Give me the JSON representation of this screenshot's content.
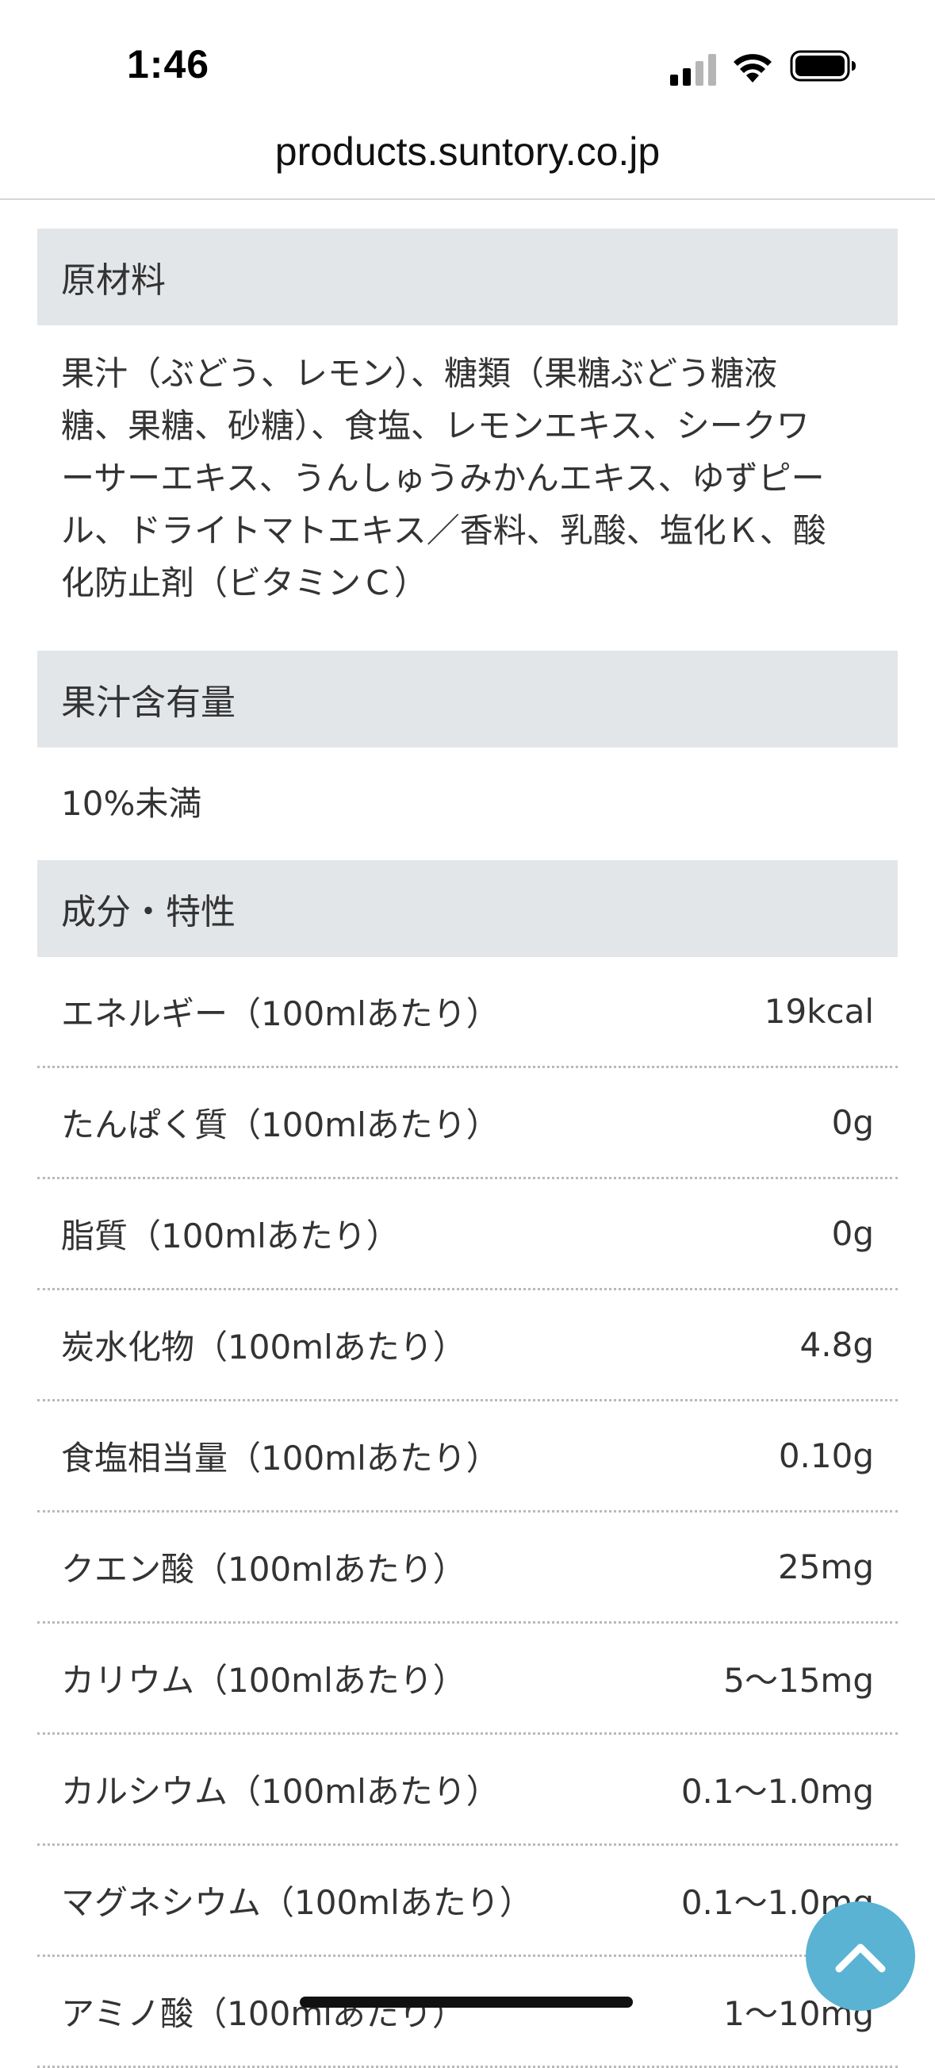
{
  "status_bar": {
    "time": "1:46"
  },
  "url_bar": {
    "domain": "products.suntory.co.jp"
  },
  "sections": {
    "ingredients": {
      "title": "原材料",
      "lines": [
        "果汁（ぶどう、レモン）、糖類（果糖ぶどう糖液",
        "糖、果糖、砂糖）、食塩、レモンエキス、シークワ",
        "ーサーエキス、うんしゅうみかんエキス、ゆずピー",
        "ル、ドライトマトエキス／香料、乳酸、塩化Ｋ、酸",
        "化防止剤（ビタミンＣ）"
      ]
    },
    "juice_content": {
      "title": "果汁含有量",
      "value": "10%未満"
    },
    "nutrition": {
      "title": "成分・特性",
      "rows": [
        {
          "label": "エネルギー（100mlあたり）",
          "value": "19kcal"
        },
        {
          "label": "たんぱく質（100mlあたり）",
          "value": "0g"
        },
        {
          "label": "脂質（100mlあたり）",
          "value": "0g"
        },
        {
          "label": "炭水化物（100mlあたり）",
          "value": "4.8g"
        },
        {
          "label": "食塩相当量（100mlあたり）",
          "value": "0.10g"
        },
        {
          "label": "クエン酸（100mlあたり）",
          "value": "25mg"
        },
        {
          "label": "カリウム（100mlあたり）",
          "value": "5〜15mg"
        },
        {
          "label": "カルシウム（100mlあたり）",
          "value": "0.1〜1.0mg"
        },
        {
          "label": "マグネシウム（100mlあたり）",
          "value": "0.1〜1.0mg"
        },
        {
          "label": "アミノ酸（100mlあたり）",
          "value": "1〜10mg"
        }
      ]
    }
  },
  "back_to_top": {
    "icon": "chevron-up-icon",
    "color": "#5ab3d3"
  }
}
